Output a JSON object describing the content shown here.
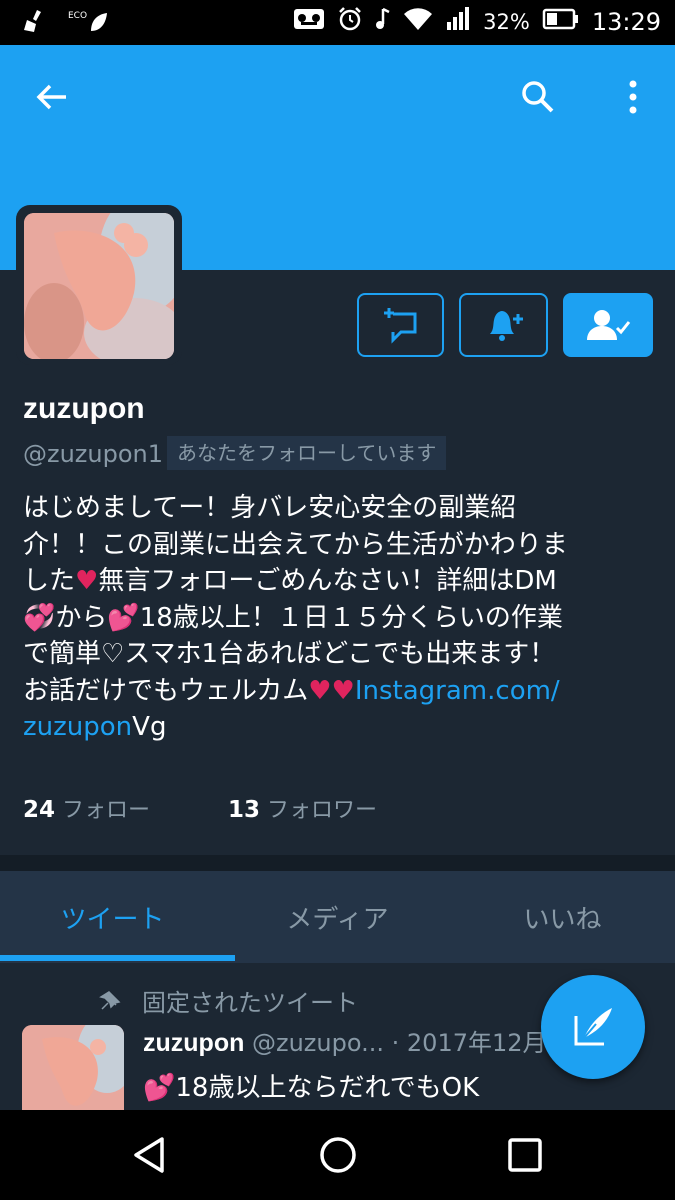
{
  "status_bar": {
    "eco_label": "ECO",
    "battery_percent": "32%",
    "time": "13:29",
    "icons": [
      "broom-icon",
      "eco-leaf-icon",
      "voicemail-icon",
      "alarm-icon",
      "music-note-icon",
      "wifi-icon",
      "signal-icon",
      "battery-icon"
    ]
  },
  "header": {
    "color": "#1da1f2",
    "icons": [
      "back-arrow-icon",
      "search-icon",
      "more-vert-icon"
    ]
  },
  "profile": {
    "display_name": "zuzupon",
    "handle": "@zuzupon1",
    "follows_you": "あなたをフォローしています",
    "bio": {
      "line1": "はじめましてー！身バレ安心安全の副業紹",
      "line2": "介！！この副業に出会えてから生活がかわりま",
      "line3a": "した",
      "heart1": "♥",
      "line3b": "無言フォローごめんなさい！詳細はDM",
      "heart2": "💞",
      "line4a": "から",
      "heart3": "💕",
      "line4b": "18歳以上！１日１５分くらいの作業",
      "line5": "で簡単♡スマホ1台あればどこでも出来ます！",
      "line6a": "お話だけでもウェルカム",
      "heart4": "♥♥",
      "link1": "Instagram.com/",
      "link2": "zuzupon",
      "line7b": "Vg"
    },
    "following_count": "24",
    "following_label": "フォロー",
    "followers_count": "13",
    "followers_label": "フォロワー"
  },
  "tabs": [
    {
      "label": "ツイート",
      "active": true
    },
    {
      "label": "メディア",
      "active": false
    },
    {
      "label": "いいね",
      "active": false
    }
  ],
  "pinned_tweet": {
    "pinned_label": "固定されたツイート",
    "name": "zuzupon",
    "handle": "@zuzupo...",
    "date": "· 2017年12月",
    "heart": "💕",
    "text": "18歳以上ならだれでもOK"
  },
  "accent_color": "#1da1f2"
}
